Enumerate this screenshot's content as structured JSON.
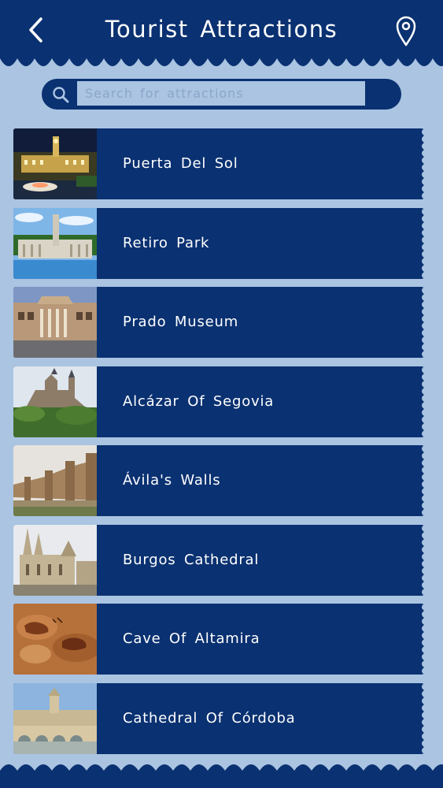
{
  "header": {
    "title": "Tourist Attractions",
    "back_icon": "chevron-left-icon",
    "location_icon": "map-pin-icon"
  },
  "search": {
    "placeholder": "Search for attractions",
    "value": "",
    "search_icon": "magnifier-icon",
    "clear_icon": "close-icon"
  },
  "attractions": [
    {
      "name": "Puerta Del Sol",
      "thumb": "night-plaza-photo"
    },
    {
      "name": "Retiro Park",
      "thumb": "monument-lake-photo"
    },
    {
      "name": "Prado Museum",
      "thumb": "museum-facade-photo"
    },
    {
      "name": "Alcázar Of Segovia",
      "thumb": "castle-photo"
    },
    {
      "name": "Ávila's Walls",
      "thumb": "city-walls-photo"
    },
    {
      "name": "Burgos Cathedral",
      "thumb": "gothic-cathedral-photo"
    },
    {
      "name": "Cave Of Altamira",
      "thumb": "cave-painting-photo"
    },
    {
      "name": "Cathedral Of Córdoba",
      "thumb": "bridge-cathedral-photo"
    }
  ],
  "colors": {
    "primary": "#0a3171",
    "background": "#aac4e2",
    "text": "#ffffff"
  }
}
